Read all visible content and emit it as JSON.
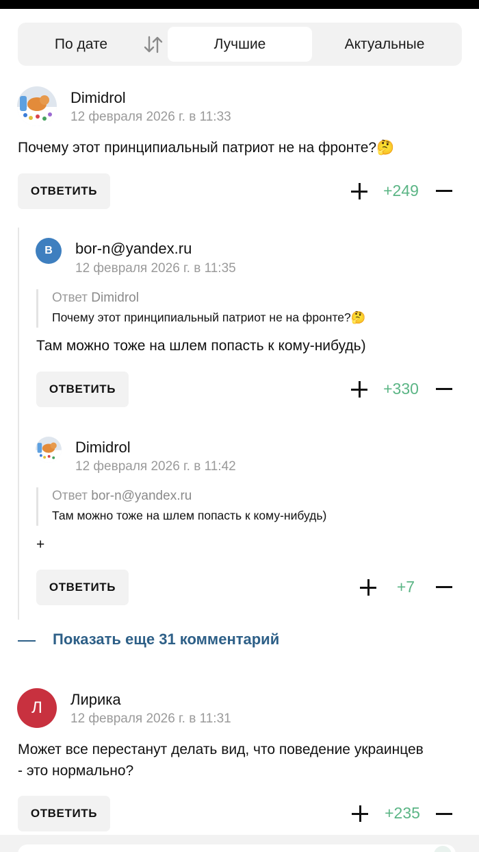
{
  "sort": {
    "by_date": "По дате",
    "best": "Лучшие",
    "actual": "Актуальные"
  },
  "comments": [
    {
      "author": "Dimidrol",
      "date": "12 февраля 2026 г. в 11:33",
      "text": "Почему этот принципиальный патриот не на фронте?🤔",
      "reply": "ОТВЕТИТЬ",
      "score": "+249"
    },
    {
      "avatar_letter": "B",
      "author": "bor-n@yandex.ru",
      "date": "12 февраля 2026 г. в 11:35",
      "quote_prefix": "Ответ",
      "quote_author": "Dimidrol",
      "quote_text": "Почему этот принципиальный патриот не на фронте?🤔",
      "text": "Там можно тоже на шлем попасть к кому-нибудь)",
      "reply": "ОТВЕТИТЬ",
      "score": "+330"
    },
    {
      "author": "Dimidrol",
      "date": "12 февраля 2026 г. в 11:42",
      "quote_prefix": "Ответ",
      "quote_author": "bor-n@yandex.ru",
      "quote_text": "Там можно тоже на шлем попасть к кому-нибудь)",
      "text": "+",
      "reply": "ОТВЕТИТЬ",
      "score": "+7"
    },
    {
      "avatar_letter": "Л",
      "author": "Лирика",
      "date": "12 февраля 2026 г. в 11:31",
      "text_line1": "Может все перестанут делать вид, что поведение украинцев",
      "text_line2": "- это нормально?",
      "reply": "ОТВЕТИТЬ",
      "score": "+235"
    }
  ],
  "show_more": "Показать еще 31 комментарий",
  "colors": {
    "score_green": "#5bb585",
    "link_blue": "#2d5f87",
    "avatar_blue": "#3e7fbf",
    "avatar_red": "#c8313f"
  }
}
